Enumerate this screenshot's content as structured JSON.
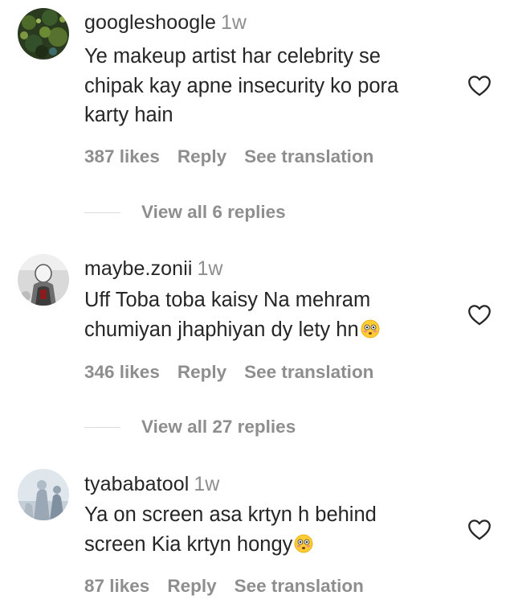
{
  "comments": [
    {
      "username": "googleshoogle",
      "time": "1w",
      "lines": [
        "Ye makeup artist har celebrity se",
        "chipak kay apne insecurity ko pora",
        "karty hain"
      ],
      "likes": "387 likes",
      "reply": "Reply",
      "translation": "See translation",
      "view_replies": "View all 6 replies",
      "avatar_icon": "dark-green-textured-avatar",
      "like_icon": "heart-outline-icon"
    },
    {
      "username": "maybe.zonii",
      "time": "1w",
      "lines": [
        "Uff Toba toba kaisy Na mehram",
        "chumiyan jhaphiyan dy lety hn"
      ],
      "emoji": "flushed-face-emoji",
      "likes": "346 likes",
      "reply": "Reply",
      "translation": "See translation",
      "view_replies": "View all 27 replies",
      "avatar_icon": "grey-figure-avatar",
      "like_icon": "heart-outline-icon"
    },
    {
      "username": "tyababatool",
      "time": "1w",
      "lines": [
        "Ya on screen asa krtyn h behind",
        "screen Kia krtyn hongy"
      ],
      "emoji": "flushed-face-emoji",
      "likes": "87 likes",
      "reply": "Reply",
      "translation": "See translation",
      "avatar_icon": "blue-grey-figure-avatar",
      "like_icon": "heart-outline-icon"
    }
  ],
  "colors": {
    "primary_text": "#262626",
    "secondary_text": "#8e8e8e",
    "divider": "#dbdbdb"
  }
}
